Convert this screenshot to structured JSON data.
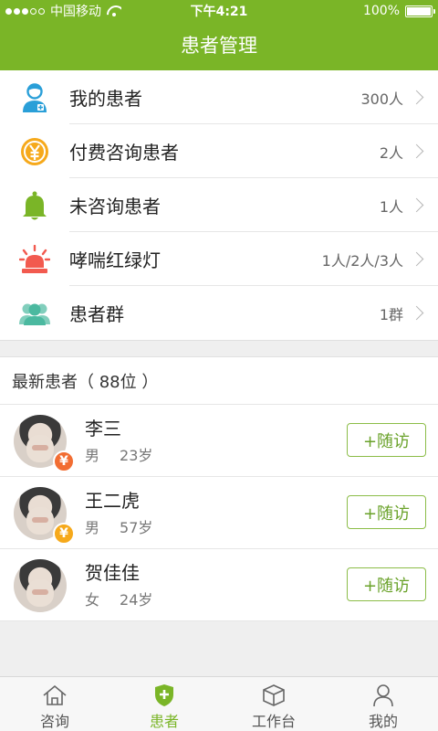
{
  "status_bar": {
    "carrier": "中国移动",
    "time": "下午4:21",
    "battery": "100%",
    "battery_level": 1.0
  },
  "header": {
    "title": "患者管理"
  },
  "menu": [
    {
      "label": "我的患者",
      "value": "300人",
      "icon": "doctor-icon",
      "color": "#2a9fd8"
    },
    {
      "label": "付费咨询患者",
      "value": "2人",
      "icon": "yen-coin-icon",
      "color": "#f6a91b"
    },
    {
      "label": "未咨询患者",
      "value": "1人",
      "icon": "bell-icon",
      "color": "#7ab527"
    },
    {
      "label": "哮喘红绿灯",
      "value": "1人/2人/3人",
      "icon": "alarm-light-icon",
      "color": "#f25a4f"
    },
    {
      "label": "患者群",
      "value": "1群",
      "icon": "group-icon",
      "color": "#4bb9a0"
    }
  ],
  "recent": {
    "title": "最新患者（ 88位 ）",
    "patients": [
      {
        "name": "李三",
        "gender": "男",
        "age": "23岁",
        "badge": "¥",
        "badge_color": "red",
        "button": "+随访"
      },
      {
        "name": "王二虎",
        "gender": "男",
        "age": "57岁",
        "badge": "¥",
        "badge_color": "orange",
        "button": "+随访"
      },
      {
        "name": "贺佳佳",
        "gender": "女",
        "age": "24岁",
        "badge": "",
        "badge_color": "",
        "button": "+随访"
      }
    ]
  },
  "tabs": [
    {
      "label": "咨询",
      "icon": "home-icon",
      "active": false
    },
    {
      "label": "患者",
      "icon": "shield-plus-icon",
      "active": true
    },
    {
      "label": "工作台",
      "icon": "cube-icon",
      "active": false
    },
    {
      "label": "我的",
      "icon": "person-icon",
      "active": false
    }
  ],
  "colors": {
    "accent": "#7ab527",
    "background": "#efefef"
  }
}
